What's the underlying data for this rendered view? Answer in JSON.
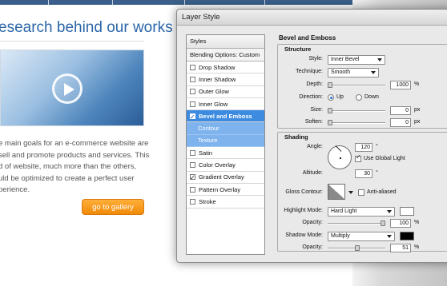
{
  "web": {
    "heading": "esearch behind our works",
    "body_lines": [
      "e main goals for an e-commerce website are",
      "sell and promote products and services. This",
      "d of website, much more than the others,",
      "uld be optimized to create a perfect user",
      "perience."
    ],
    "cta_label": "go to gallery"
  },
  "dialog": {
    "title": "Layer Style",
    "left_panel": {
      "styles_label": "Styles",
      "blending_label": "Blending Options: Custom",
      "items": [
        {
          "label": "Drop Shadow",
          "checked": false,
          "state": "normal"
        },
        {
          "label": "Inner Shadow",
          "checked": false,
          "state": "normal"
        },
        {
          "label": "Outer Glow",
          "checked": false,
          "state": "normal"
        },
        {
          "label": "Inner Glow",
          "checked": false,
          "state": "normal"
        },
        {
          "label": "Bevel and Emboss",
          "checked": true,
          "state": "active"
        },
        {
          "label": "Contour",
          "checked": false,
          "state": "sub"
        },
        {
          "label": "Texture",
          "checked": false,
          "state": "sub"
        },
        {
          "label": "Satin",
          "checked": false,
          "state": "normal"
        },
        {
          "label": "Color Overlay",
          "checked": false,
          "state": "normal"
        },
        {
          "label": "Gradient Overlay",
          "checked": true,
          "state": "normal"
        },
        {
          "label": "Pattern Overlay",
          "checked": false,
          "state": "normal"
        },
        {
          "label": "Stroke",
          "checked": false,
          "state": "normal"
        }
      ]
    },
    "bevel": {
      "heading": "Bevel and Emboss",
      "structure_title": "Structure",
      "style_label": "Style:",
      "style_value": "Inner Bevel",
      "technique_label": "Technique:",
      "technique_value": "Smooth",
      "depth_label": "Depth:",
      "depth_value": "1000",
      "depth_unit": "%",
      "direction_label": "Direction:",
      "direction_up": "Up",
      "direction_down": "Down",
      "direction_selected": "Up",
      "size_label": "Size:",
      "size_value": "0",
      "size_unit": "px",
      "soften_label": "Soften:",
      "soften_value": "0",
      "soften_unit": "px"
    },
    "shading": {
      "title": "Shading",
      "angle_label": "Angle:",
      "angle_value": "120",
      "angle_unit": "°",
      "global_light_label": "Use Global Light",
      "global_light_checked": true,
      "altitude_label": "Altitude:",
      "altitude_value": "30",
      "altitude_unit": "°",
      "gloss_label": "Gloss Contour:",
      "anti_aliased_label": "Anti-aliased",
      "anti_aliased_checked": false,
      "highlight_mode_label": "Highlight Mode:",
      "highlight_mode_value": "Hard Light",
      "highlight_color": "#ffffff",
      "highlight_opacity_label": "Opacity:",
      "highlight_opacity_value": "100",
      "highlight_opacity_unit": "%",
      "shadow_mode_label": "Shadow Mode:",
      "shadow_mode_value": "Multiply",
      "shadow_color": "#000000",
      "shadow_opacity_label": "Opacity:",
      "shadow_opacity_value": "51",
      "shadow_opacity_unit": "%"
    }
  }
}
